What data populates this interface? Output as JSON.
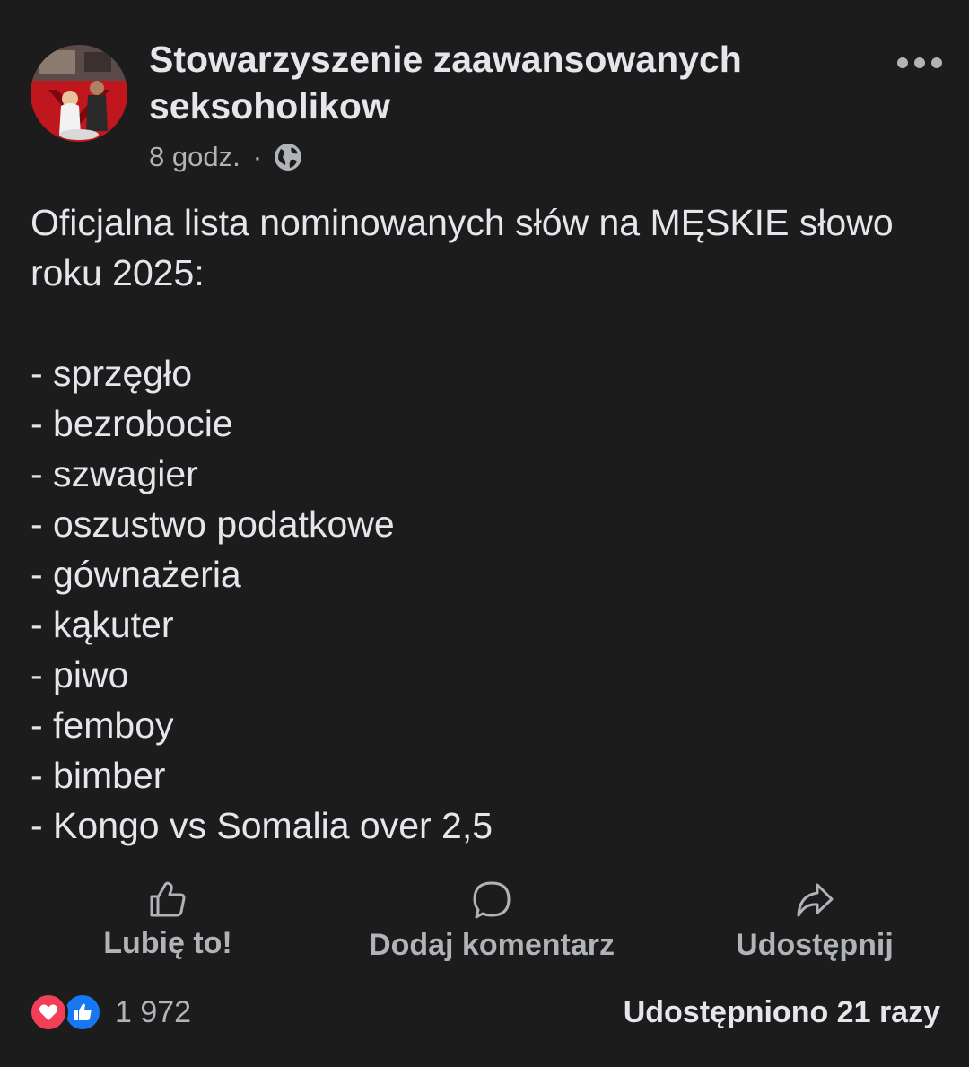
{
  "header": {
    "group_name": "Stowarzyszenie zaawansowanych seksoholikow",
    "time": "8 godz.",
    "separator": "·",
    "privacy_icon": "globe-icon",
    "more_icon": "more-dots-icon"
  },
  "post": {
    "intro": "Oficjalna lista nominowanych słów na MĘSKIE słowo roku 2025:",
    "items": [
      "- sprzęgło",
      "- bezrobocie",
      "- szwagier",
      "- oszustwo podatkowe",
      "- gównażeria",
      "- kąkuter",
      "- piwo",
      "- femboy",
      "- bimber",
      "- Kongo vs Somalia over 2,5"
    ]
  },
  "actions": {
    "like_label": "Lubię to!",
    "like_icon": "thumbs-up-icon",
    "comment_label": "Dodaj komentarz",
    "comment_icon": "comment-bubble-icon",
    "share_label": "Udostępnij",
    "share_icon": "share-arrow-icon"
  },
  "stats": {
    "reaction_icons": [
      "heart-reaction-icon",
      "like-reaction-icon"
    ],
    "reaction_count": "1 972",
    "shares": "Udostępniono 21 razy"
  },
  "colors": {
    "background": "#1c1c1d",
    "primary_text": "#e4e6eb",
    "secondary_text": "#b0b3b8",
    "love": "#f33e58",
    "like": "#1877f2"
  }
}
